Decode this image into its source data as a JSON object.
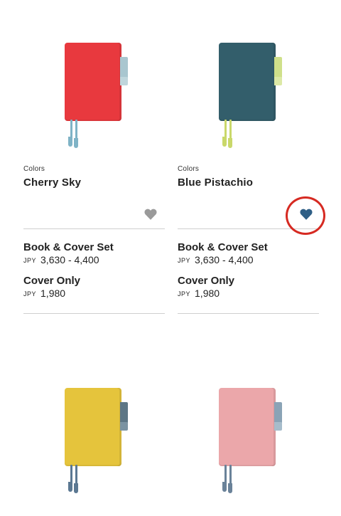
{
  "products": [
    {
      "colors_label": "Colors",
      "name": "Cherry Sky",
      "cover_color": "#e8393e",
      "tab_color": "#a9c6cf",
      "ribbon_color": "#7fb3c6",
      "favorite_icon": "heart-icon",
      "favorited": false,
      "heart_color": "#9a9a9a",
      "options": [
        {
          "title": "Book & Cover Set",
          "currency": "JPY",
          "price": "3,630 - 4,400"
        },
        {
          "title": "Cover Only",
          "currency": "JPY",
          "price": "1,980"
        }
      ]
    },
    {
      "colors_label": "Colors",
      "name": "Blue Pistachio",
      "cover_color": "#335e6b",
      "tab_color": "#cfe08a",
      "ribbon_color": "#c9d86a",
      "favorite_icon": "heart-icon",
      "favorited": true,
      "heart_color": "#2f5f86",
      "options": [
        {
          "title": "Book & Cover Set",
          "currency": "JPY",
          "price": "3,630 - 4,400"
        },
        {
          "title": "Cover Only",
          "currency": "JPY",
          "price": "1,980"
        }
      ]
    },
    {
      "cover_color": "#e5c43c",
      "tab_color": "#5d7685",
      "ribbon_color": "#5b7892"
    },
    {
      "cover_color": "#eba7aa",
      "tab_color": "#8aa3b6",
      "ribbon_color": "#6a8299"
    }
  ],
  "highlight_color": "#d62a22"
}
